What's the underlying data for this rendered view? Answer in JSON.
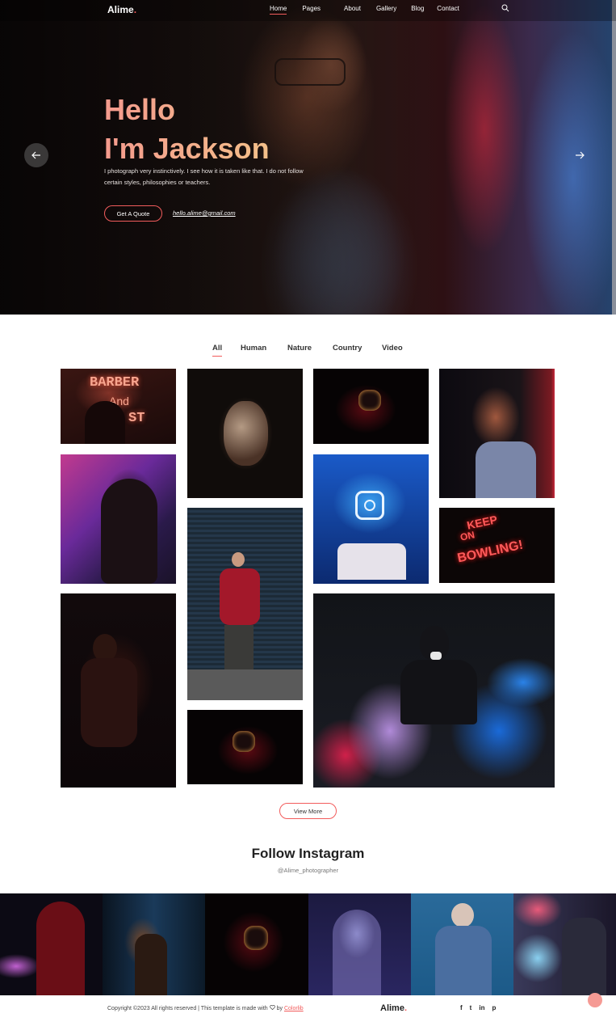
{
  "brand": {
    "name": "Alime",
    "dot": ".",
    "accent": "#f25c5c"
  },
  "nav": {
    "items": [
      {
        "label": "Home",
        "active": true
      },
      {
        "label": "Pages",
        "active": false
      },
      {
        "label": "About",
        "active": false
      },
      {
        "label": "Gallery",
        "active": false
      },
      {
        "label": "Blog",
        "active": false
      },
      {
        "label": "Contact",
        "active": false
      }
    ],
    "search_icon": "search-icon"
  },
  "hero": {
    "line1": "Hello",
    "line2": "I'm Jackson",
    "description": "I photograph very instinctively. I see how it is taken like that. I do not follow certain styles, philosophies or teachers.",
    "quote_button": "Get A Quote",
    "email": "hello.alime@gmail.com",
    "prev_icon": "arrow-left-icon",
    "next_icon": "arrow-right-icon"
  },
  "filters": [
    {
      "label": "All",
      "active": true
    },
    {
      "label": "Human",
      "active": false
    },
    {
      "label": "Nature",
      "active": false
    },
    {
      "label": "Country",
      "active": false
    },
    {
      "label": "Video",
      "active": false
    }
  ],
  "gallery": {
    "items": [
      {
        "name": "barber-neon-photo",
        "neon_text": [
          "BARBER",
          "And",
          "ST"
        ]
      },
      {
        "name": "painted-face-photo"
      },
      {
        "name": "purge-mask-photo"
      },
      {
        "name": "man-red-light-photo"
      },
      {
        "name": "curly-hair-portrait-photo"
      },
      {
        "name": "instagram-neon-photo"
      },
      {
        "name": "bowling-neon-photo",
        "neon_text": [
          "KEEP",
          "ON",
          "BOWLING!"
        ]
      },
      {
        "name": "man-crouching-photo"
      },
      {
        "name": "woman-garage-photo"
      },
      {
        "name": "purge-mask-photo-2"
      },
      {
        "name": "smoke-bomb-photo"
      }
    ],
    "view_more": "View More"
  },
  "instagram": {
    "title": "Follow Instagram",
    "handle": "@Alime_photographer",
    "photos": [
      "red-hoodie-photo",
      "street-night-photo",
      "purge-mask-photo-3",
      "woman-blue-light-photo",
      "woman-denim-photo",
      "neon-sign-man-photo"
    ]
  },
  "footer": {
    "copyright": "Copyright ©2023 All rights reserved | This template is made with",
    "by": "by",
    "credit": "Colorlib",
    "heart_icon": "heart-icon",
    "social": [
      {
        "icon": "facebook-icon",
        "glyph": "f"
      },
      {
        "icon": "twitter-icon",
        "glyph": "t"
      },
      {
        "icon": "linkedin-icon",
        "glyph": "in"
      },
      {
        "icon": "pinterest-icon",
        "glyph": "p"
      }
    ]
  }
}
